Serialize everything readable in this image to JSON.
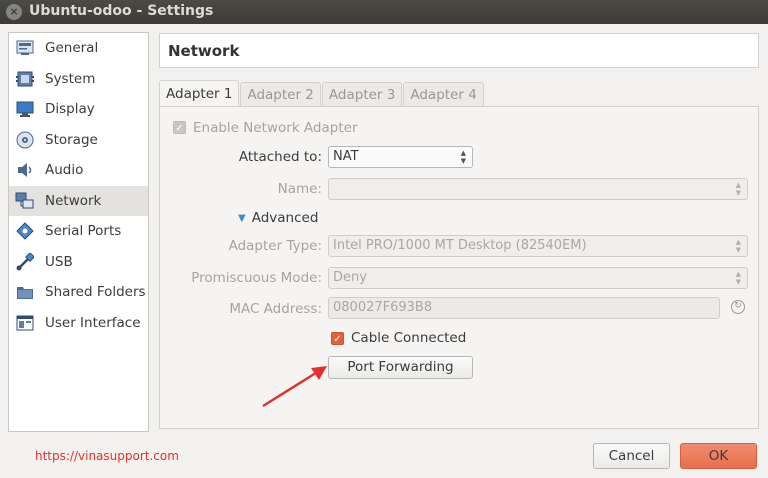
{
  "window": {
    "title": "Ubuntu-odoo - Settings",
    "close_glyph": "×"
  },
  "sidebar": {
    "items": [
      {
        "label": "General",
        "icon": "general-icon"
      },
      {
        "label": "System",
        "icon": "system-icon"
      },
      {
        "label": "Display",
        "icon": "display-icon"
      },
      {
        "label": "Storage",
        "icon": "storage-icon"
      },
      {
        "label": "Audio",
        "icon": "audio-icon"
      },
      {
        "label": "Network",
        "icon": "network-icon",
        "selected": true
      },
      {
        "label": "Serial Ports",
        "icon": "serial-ports-icon"
      },
      {
        "label": "USB",
        "icon": "usb-icon"
      },
      {
        "label": "Shared Folders",
        "icon": "shared-folders-icon"
      },
      {
        "label": "User Interface",
        "icon": "user-interface-icon"
      }
    ]
  },
  "header": {
    "title": "Network"
  },
  "tabs": [
    {
      "label": "Adapter 1",
      "active": true
    },
    {
      "label": "Adapter 2"
    },
    {
      "label": "Adapter 3"
    },
    {
      "label": "Adapter 4"
    }
  ],
  "adapter": {
    "enable_label": "Enable Network Adapter",
    "enable_checked": true,
    "attached_label": "Attached to:",
    "attached_value": "NAT",
    "name_label": "Name:",
    "name_value": "",
    "advanced_label": "Advanced",
    "adapter_type_label": "Adapter Type:",
    "adapter_type_value": "Intel PRO/1000 MT Desktop (82540EM)",
    "promiscuous_label": "Promiscuous Mode:",
    "promiscuous_value": "Deny",
    "mac_label": "MAC Address:",
    "mac_value": "080027F693B8",
    "cable_label": "Cable Connected",
    "cable_checked": true,
    "port_forwarding_label": "Port Forwarding"
  },
  "footer": {
    "link_text": "https://vinasupport.com",
    "cancel_label": "Cancel",
    "ok_label": "OK"
  },
  "colors": {
    "accent": "#e2623a",
    "annotation_arrow": "#e0322a",
    "link": "#e0322a"
  }
}
